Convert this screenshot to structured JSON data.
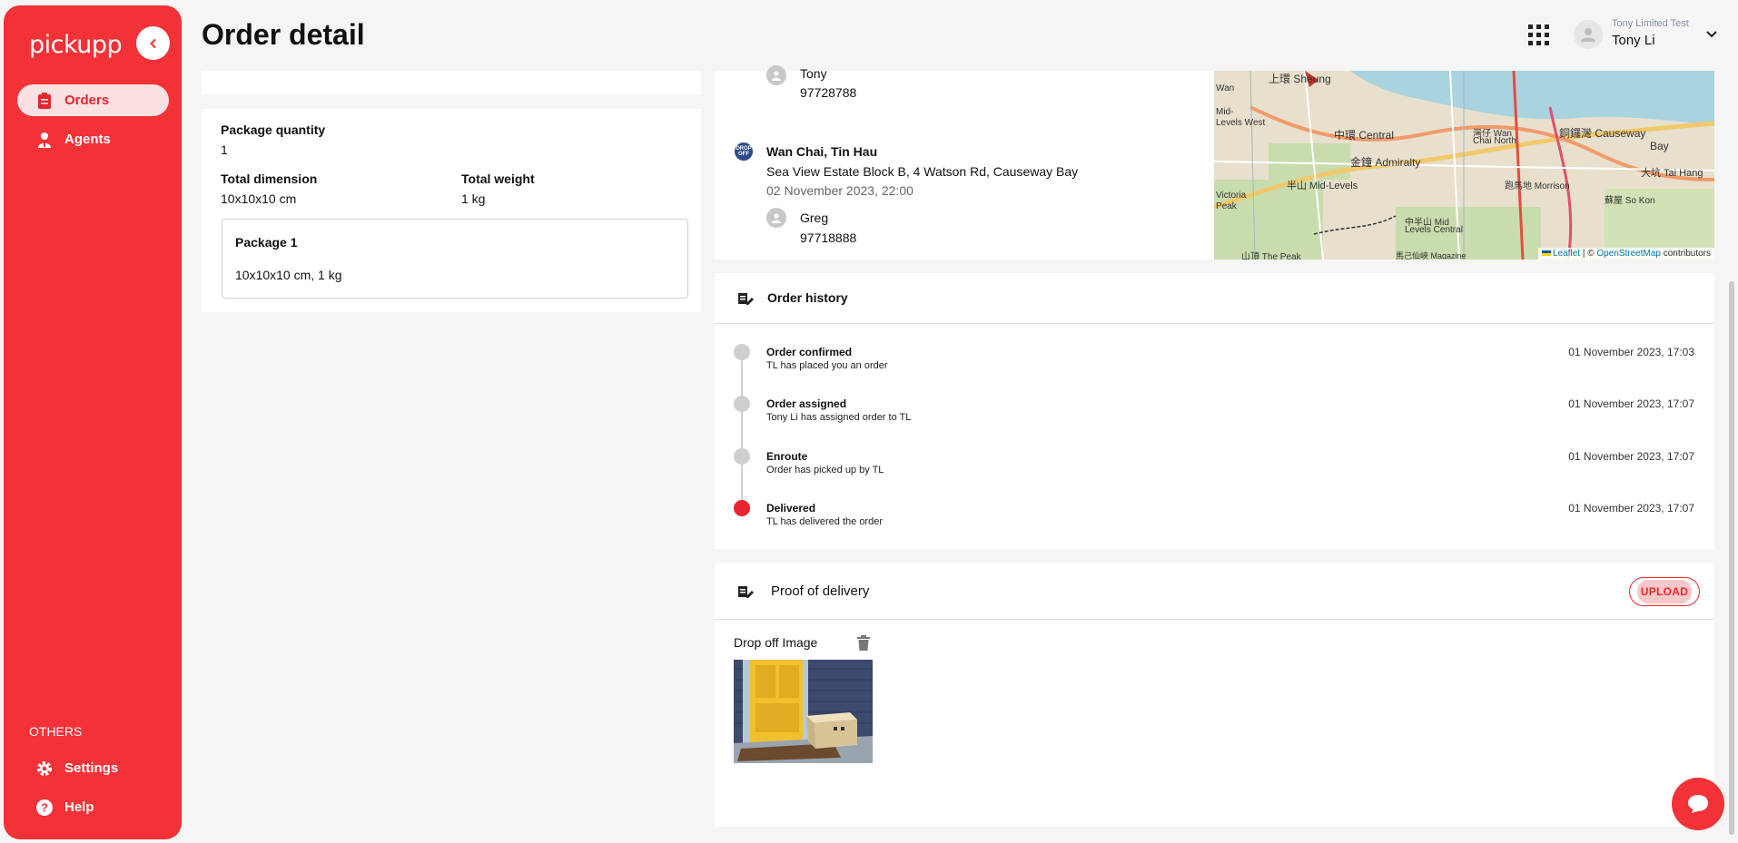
{
  "app": {
    "logo": "pickupp"
  },
  "sidebar": {
    "items": [
      {
        "label": "Orders",
        "icon": "clipboard-icon",
        "active": true
      },
      {
        "label": "Agents",
        "icon": "agent-icon",
        "active": false
      }
    ],
    "others_label": "OTHERS",
    "others": [
      {
        "label": "Settings",
        "icon": "gear-icon"
      },
      {
        "label": "Help",
        "icon": "help-icon"
      }
    ]
  },
  "header": {
    "title": "Order detail",
    "user_company": "Tony Limited Test",
    "user_name": "Tony Li"
  },
  "package": {
    "quantity_label": "Package quantity",
    "quantity": "1",
    "dimension_label": "Total dimension",
    "dimension": "10x10x10 cm",
    "weight_label": "Total weight",
    "weight": "1 kg",
    "item_title": "Package 1",
    "item_desc": "10x10x10 cm, 1 kg"
  },
  "pickup_contact": {
    "name": "Tony",
    "phone": "97728788"
  },
  "dropoff": {
    "badge": "DROP OFF",
    "area": "Wan Chai, Tin Hau",
    "address": "Sea View Estate Block B, 4 Watson Rd, Causeway Bay",
    "time": "02 November 2023, 22:00",
    "contact_name": "Greg",
    "contact_phone": "97718888"
  },
  "map": {
    "attrib_leaflet": "Leaflet",
    "attrib_sep": " | © ",
    "attrib_osm": "OpenStreetMap",
    "attrib_contrib": " contributors",
    "labels": [
      "Wan",
      "Mid-",
      "Levels West",
      "中環 Central",
      "上環 Sheung",
      "金鐘 Admiralty",
      "灣仔 Wan",
      "Chai North",
      "銅鑼灣 Causeway",
      "Bay",
      "大坑 Tai Hang",
      "蘇屋 So Kon",
      "半山 Mid-Levels",
      "Victoria",
      "Peak",
      "中半山 Mid",
      "Levels Central",
      "山頂 The Peak",
      "馬己仙峽 Magazine",
      "跑馬地 Morrison"
    ]
  },
  "history": {
    "title": "Order history",
    "events": [
      {
        "title": "Order confirmed",
        "desc": "TL has placed you an order",
        "time": "01 November 2023, 17:03"
      },
      {
        "title": "Order assigned",
        "desc": "Tony Li has assigned order to TL",
        "time": "01 November 2023, 17:07"
      },
      {
        "title": "Enroute",
        "desc": "Order has picked up by TL",
        "time": "01 November 2023, 17:07"
      },
      {
        "title": "Delivered",
        "desc": "TL has delivered the order",
        "time": "01 November 2023, 17:07"
      }
    ]
  },
  "proof": {
    "title": "Proof of delivery",
    "upload_label": "UPLOAD",
    "image_label": "Drop off Image"
  },
  "colors": {
    "brand": "#f23237",
    "active_bg": "#fbe1e2"
  }
}
